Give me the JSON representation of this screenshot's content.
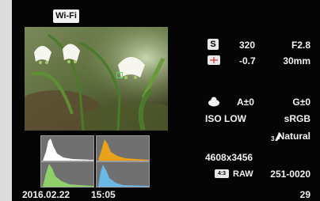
{
  "wifi_label": "Wi-Fi",
  "date": "2016.02.22",
  "time": "15:05",
  "mode_label": "S",
  "shutter": "320",
  "aperture": "F2.8",
  "exposure_comp": "-0.7",
  "focal_length": "30mm",
  "wb_comp": "A±0",
  "wb_g": "G±0",
  "iso": "ISO LOW",
  "color_space": "sRGB",
  "picture_mode": "Natural",
  "resolution": "4608x3456",
  "aspect_label": "4:3",
  "raw_label": "RAW",
  "file_number": "251-0020",
  "frame_count": "29",
  "colors": {
    "histogram_white": "#ffffff",
    "histogram_orange": "#e8a31a",
    "histogram_green": "#8fd06a",
    "histogram_blue": "#6ab8e6"
  }
}
